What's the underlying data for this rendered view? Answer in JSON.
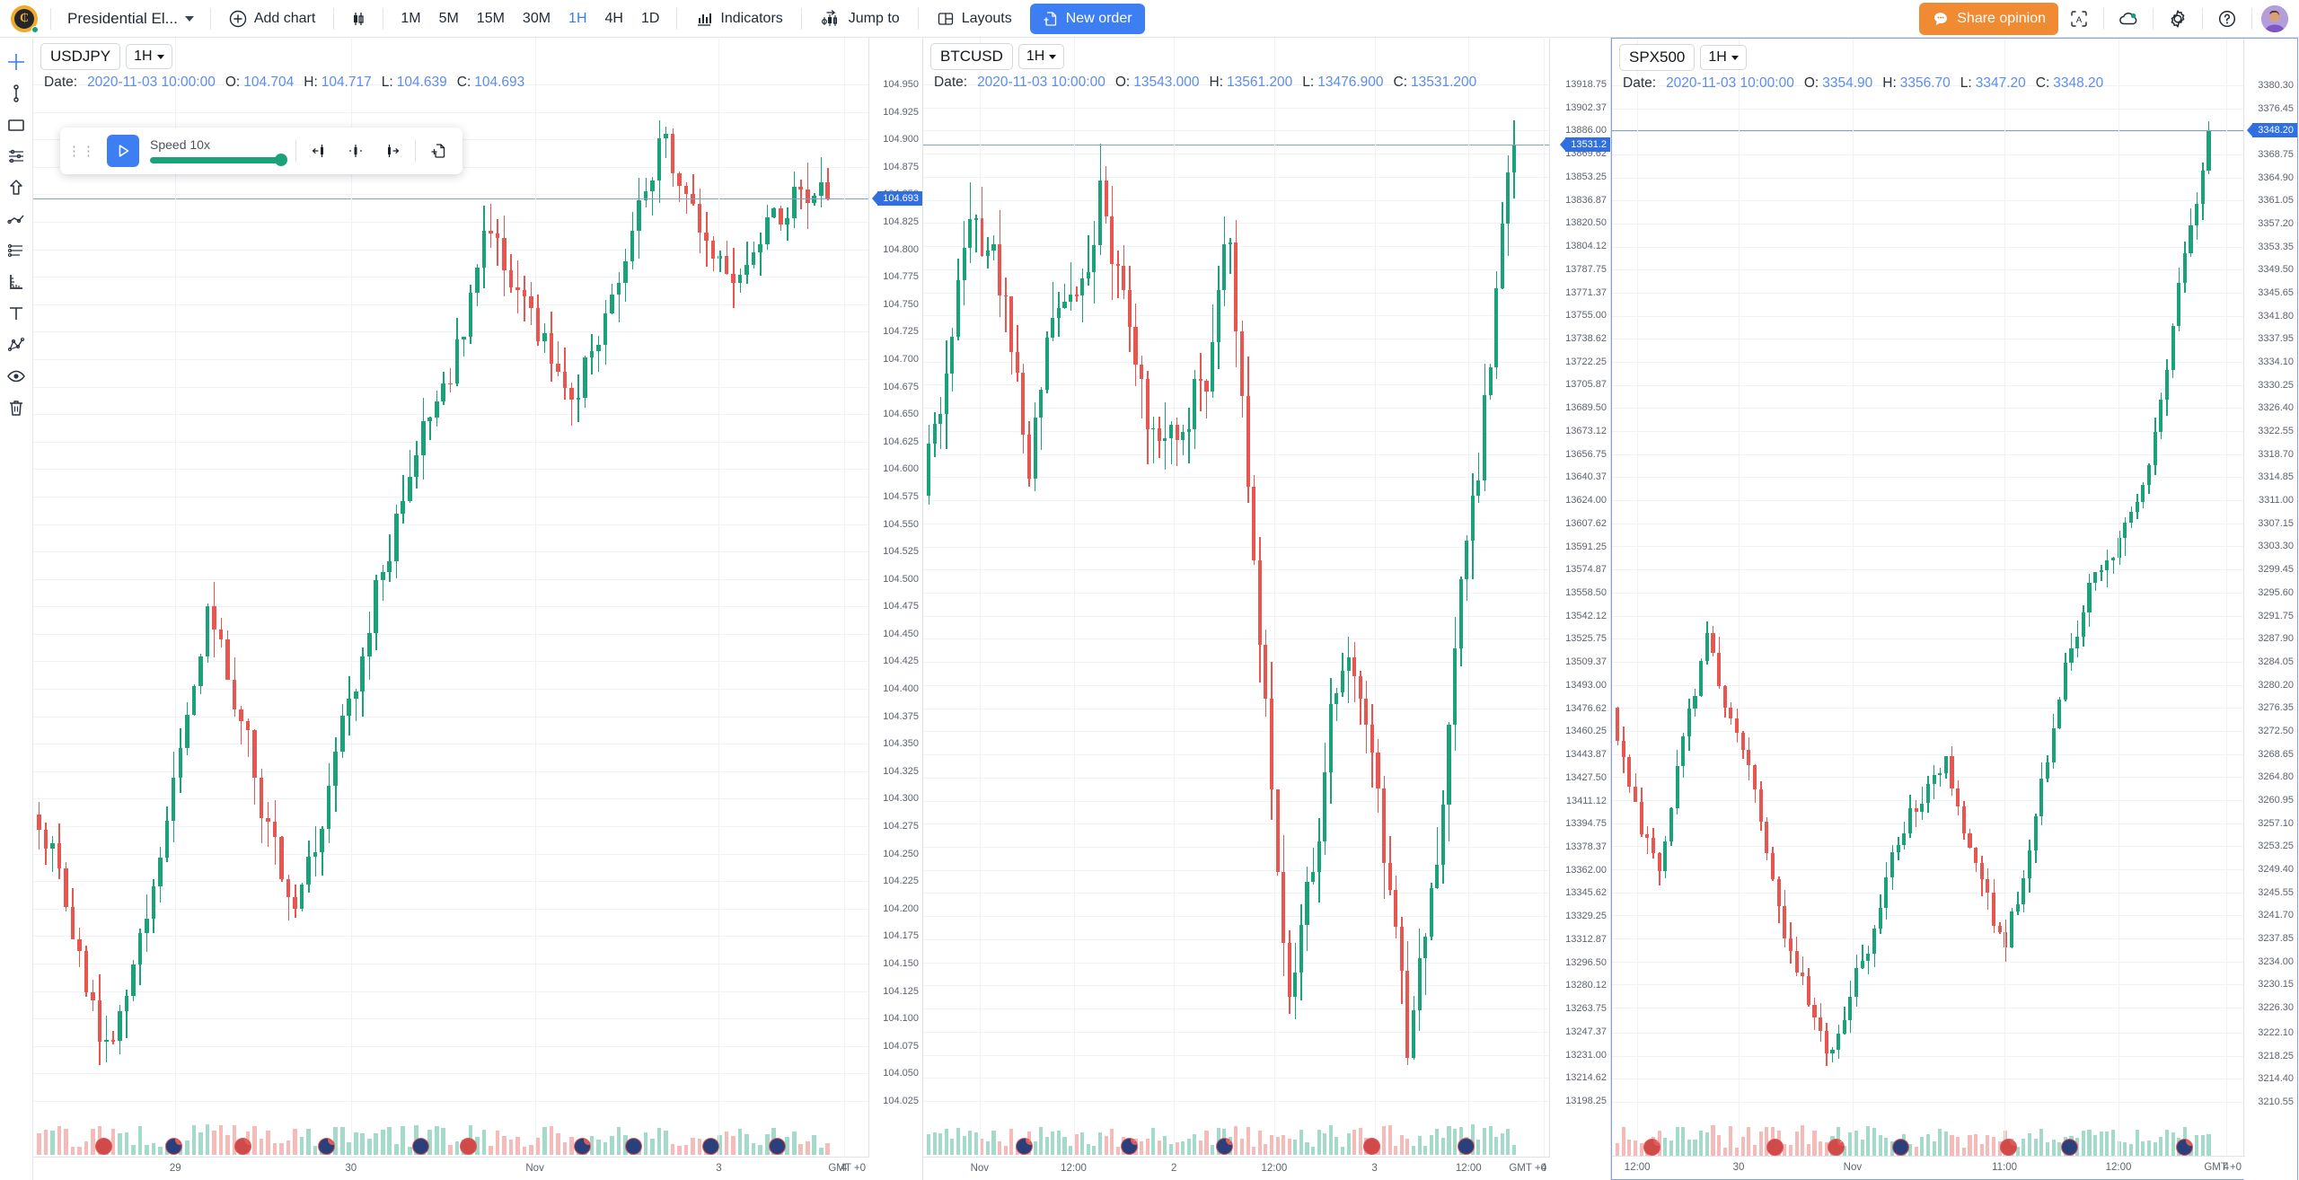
{
  "topbar": {
    "logo_letter": "₵",
    "layout_name": "Presidential El...",
    "add_chart_label": "Add chart",
    "candles_icon": "candlestick-icon",
    "timeframes": [
      {
        "label": "1M",
        "active": false
      },
      {
        "label": "5M",
        "active": false
      },
      {
        "label": "15M",
        "active": false
      },
      {
        "label": "30M",
        "active": false
      },
      {
        "label": "1H",
        "active": true
      },
      {
        "label": "4H",
        "active": false
      },
      {
        "label": "1D",
        "active": false
      }
    ],
    "indicators_label": "Indicators",
    "jump_to_label": "Jump to",
    "layouts_label": "Layouts",
    "new_order_label": "New order",
    "share_opinion_label": "Share opinion",
    "accent_blue": "#3d7ff2",
    "accent_orange": "#f08b34"
  },
  "left_toolbar": {
    "items": [
      {
        "name": "crosshair-tool",
        "active": true
      },
      {
        "name": "vertical-line-tool",
        "active": false
      },
      {
        "name": "rectangle-tool",
        "active": false
      },
      {
        "name": "fibonacci-tool",
        "active": false
      },
      {
        "name": "arrow-up-tool",
        "active": false
      },
      {
        "name": "trend-line-tool",
        "active": false
      },
      {
        "name": "parallel-channel-tool",
        "active": false
      },
      {
        "name": "measure-tool",
        "active": false
      },
      {
        "name": "text-tool",
        "active": false
      },
      {
        "name": "pattern-tool",
        "active": false
      },
      {
        "name": "visibility-tool",
        "active": false
      },
      {
        "name": "delete-tool",
        "active": false
      }
    ]
  },
  "replay": {
    "speed_label": "Speed 10x",
    "speed_percent": 92,
    "play_icon": "play-icon",
    "step_back_icon": "step-back-icon",
    "current-bar-icon": "current-bar-icon",
    "step_forward_icon": "step-forward-icon",
    "jump_icon": "jump-to-bar-icon",
    "slider_color": "#1aa37a"
  },
  "charts": [
    {
      "symbol": "USDJPY",
      "timeframe": "1H",
      "ohlc": {
        "date_label": "Date:",
        "date": "2020-11-03 10:00:00",
        "o_label": "O:",
        "o": "104.704",
        "h_label": "H:",
        "h": "104.717",
        "l_label": "L:",
        "l": "104.639",
        "c_label": "C:",
        "c": "104.693"
      },
      "current_price": "104.693",
      "gmt": "GMT +0",
      "price_ticks": [
        "104.950",
        "104.925",
        "104.900",
        "104.875",
        "104.850",
        "104.825",
        "104.800",
        "104.775",
        "104.750",
        "104.725",
        "104.700",
        "104.675",
        "104.650",
        "104.625",
        "104.600",
        "104.575",
        "104.550",
        "104.525",
        "104.500",
        "104.475",
        "104.450",
        "104.425",
        "104.400",
        "104.375",
        "104.350",
        "104.325",
        "104.300",
        "104.275",
        "104.250",
        "104.225",
        "104.200",
        "104.175",
        "104.150",
        "104.125",
        "104.100",
        "104.075",
        "104.050",
        "104.025"
      ],
      "time_ticks": [
        "29",
        "30",
        "Nov",
        "3",
        "4"
      ],
      "chart_data": {
        "type": "candlestick",
        "symbol": "USDJPY",
        "timeframe": "1H",
        "ylim": [
          104.02,
          104.96
        ],
        "bullish_color": "#1aa37a",
        "bearish_color": "#e8564f"
      }
    },
    {
      "symbol": "BTCUSD",
      "timeframe": "1H",
      "ohlc": {
        "date_label": "Date:",
        "date": "2020-11-03 10:00:00",
        "o_label": "O:",
        "o": "13543.000",
        "h_label": "H:",
        "h": "13561.200",
        "l_label": "L:",
        "l": "13476.900",
        "c_label": "C:",
        "c": "13531.200"
      },
      "current_price": "13531.2",
      "gmt": "GMT +0",
      "price_ticks": [
        "13918.75",
        "13902.37",
        "13886.00",
        "13869.62",
        "13853.25",
        "13836.87",
        "13820.50",
        "13804.12",
        "13787.75",
        "13771.37",
        "13755.00",
        "13738.62",
        "13722.25",
        "13705.87",
        "13689.50",
        "13673.12",
        "13656.75",
        "13640.37",
        "13624.00",
        "13607.62",
        "13591.25",
        "13574.87",
        "13558.50",
        "13542.12",
        "13525.75",
        "13509.37",
        "13493.00",
        "13476.62",
        "13460.25",
        "13443.87",
        "13427.50",
        "13411.12",
        "13394.75",
        "13378.37",
        "13362.00",
        "13345.62",
        "13329.25",
        "13312.87",
        "13296.50",
        "13280.12",
        "13263.75",
        "13247.37",
        "13231.00",
        "13214.62",
        "13198.25"
      ],
      "time_ticks": [
        "Nov",
        "12:00",
        "2",
        "12:00",
        "3",
        "12:00",
        "4"
      ],
      "chart_data": {
        "type": "candlestick",
        "symbol": "BTCUSD",
        "timeframe": "1H",
        "ylim": [
          13198.25,
          13918.75
        ],
        "bullish_color": "#1aa37a",
        "bearish_color": "#e8564f"
      }
    },
    {
      "symbol": "SPX500",
      "timeframe": "1H",
      "ohlc": {
        "date_label": "Date:",
        "date": "2020-11-03 10:00:00",
        "o_label": "O:",
        "o": "3354.90",
        "h_label": "H:",
        "h": "3356.70",
        "l_label": "L:",
        "l": "3347.20",
        "c_label": "C:",
        "c": "3348.20"
      },
      "current_price": "3348.20",
      "gmt": "GMT +0",
      "price_ticks": [
        "3380.30",
        "3376.45",
        "3372.60",
        "3368.75",
        "3364.90",
        "3361.05",
        "3357.20",
        "3353.35",
        "3349.50",
        "3345.65",
        "3341.80",
        "3337.95",
        "3334.10",
        "3330.25",
        "3326.40",
        "3322.55",
        "3318.70",
        "3314.85",
        "3311.00",
        "3307.15",
        "3303.30",
        "3299.45",
        "3295.60",
        "3291.75",
        "3287.90",
        "3284.05",
        "3280.20",
        "3276.35",
        "3272.50",
        "3268.65",
        "3264.80",
        "3260.95",
        "3257.10",
        "3253.25",
        "3249.40",
        "3245.55",
        "3241.70",
        "3237.85",
        "3234.00",
        "3230.15",
        "3226.30",
        "3222.10",
        "3218.25",
        "3214.40",
        "3210.55"
      ],
      "time_ticks": [
        "12:00",
        "30",
        "Nov",
        "11:00",
        "12:00",
        "4"
      ],
      "chart_data": {
        "type": "candlestick",
        "symbol": "SPX500",
        "timeframe": "1H",
        "ylim": [
          3210.55,
          3380.3
        ],
        "bullish_color": "#1aa37a",
        "bearish_color": "#e8564f"
      }
    }
  ]
}
